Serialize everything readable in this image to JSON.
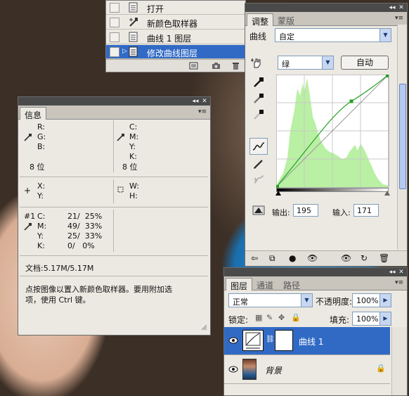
{
  "history": {
    "items": [
      {
        "label": "打开",
        "selected": false
      },
      {
        "label": "新颜色取样器",
        "selected": false
      },
      {
        "label": "曲线 1 图层",
        "selected": false
      },
      {
        "label": "修改曲线图层",
        "selected": true
      }
    ]
  },
  "info": {
    "tab": "信息",
    "rgb": {
      "r": "R:",
      "g": "G:",
      "b": "B:",
      "bits": "8 位"
    },
    "cmyk": {
      "c": "C:",
      "m": "M:",
      "y": "Y:",
      "k": "K:",
      "bits": "8 位"
    },
    "xy": {
      "x": "X:",
      "y": "Y:"
    },
    "wh": {
      "w": "W:",
      "h": "H:"
    },
    "sampler": {
      "id": "#1",
      "c_label": "C:",
      "c_val": "21/  25%",
      "m_label": "M:",
      "m_val": "49/  33%",
      "y_label": "Y:",
      "y_val": "25/  33%",
      "k_label": "K:",
      "k_val": "0/   0%"
    },
    "doc": "文档:5.17M/5.17M",
    "hint_line1": "点按图像以置入新颜色取样器。要用附加选",
    "hint_line2": "项，使用 Ctrl 键。"
  },
  "adjust": {
    "tab_active": "调整",
    "tab_inactive": "蒙版",
    "title": "曲线",
    "preset": "自定",
    "channel": "绿",
    "auto_button": "自动",
    "output_label": "输出:",
    "output_value": "195",
    "input_label": "输入:",
    "input_value": "171"
  },
  "layers": {
    "tabs": [
      "图层",
      "通道",
      "路径"
    ],
    "blend_mode": "正常",
    "opacity_label": "不透明度:",
    "opacity_value": "100%",
    "lock_label": "锁定:",
    "fill_label": "填充:",
    "fill_value": "100%",
    "rows": [
      {
        "name": "曲线 1",
        "selected": true
      },
      {
        "name": "背景",
        "selected": false
      }
    ]
  },
  "colors": {
    "selection": "#316ac5",
    "panel_bg": "#ece9e2",
    "histogram": "#b9f0a4",
    "curve": "#22a022"
  }
}
